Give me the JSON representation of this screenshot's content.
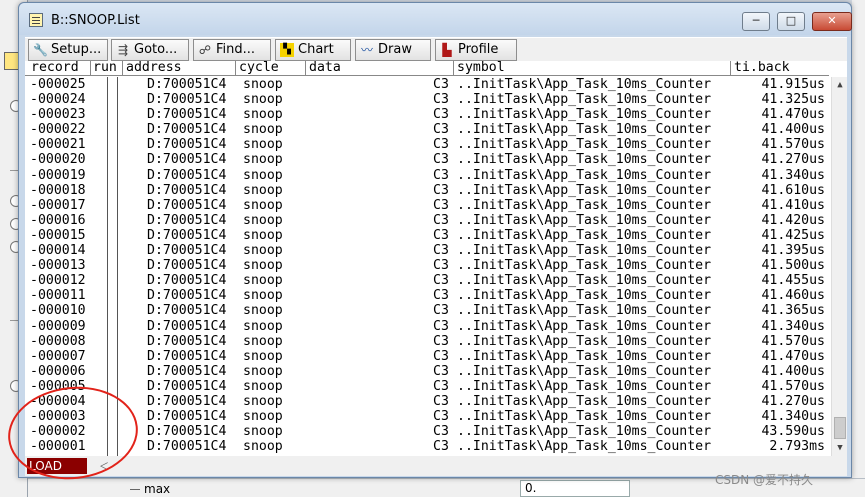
{
  "window": {
    "title": "B::SNOOP.List"
  },
  "title_buttons": {
    "minimize": "─",
    "maximize": "□",
    "close": "✕"
  },
  "toolbar": [
    {
      "label": "Setup...",
      "icon": "wrench-icon"
    },
    {
      "label": "Goto...",
      "icon": "goto-icon"
    },
    {
      "label": "Find...",
      "icon": "binoculars-icon"
    },
    {
      "label": "Chart",
      "icon": "chart-icon"
    },
    {
      "label": "Draw",
      "icon": "draw-icon"
    },
    {
      "label": "Profile",
      "icon": "profile-icon"
    }
  ],
  "columns": [
    "record",
    "run",
    "address",
    "cycle",
    "data",
    "symbol",
    "ti.back"
  ],
  "rows": [
    [
      "-000025",
      "D:700051C4",
      "snoop",
      "C3",
      "..InitTask\\App_Task_10ms_Counter",
      "41.915us"
    ],
    [
      "-000024",
      "D:700051C4",
      "snoop",
      "C3",
      "..InitTask\\App_Task_10ms_Counter",
      "41.325us"
    ],
    [
      "-000023",
      "D:700051C4",
      "snoop",
      "C3",
      "..InitTask\\App_Task_10ms_Counter",
      "41.470us"
    ],
    [
      "-000022",
      "D:700051C4",
      "snoop",
      "C3",
      "..InitTask\\App_Task_10ms_Counter",
      "41.400us"
    ],
    [
      "-000021",
      "D:700051C4",
      "snoop",
      "C3",
      "..InitTask\\App_Task_10ms_Counter",
      "41.570us"
    ],
    [
      "-000020",
      "D:700051C4",
      "snoop",
      "C3",
      "..InitTask\\App_Task_10ms_Counter",
      "41.270us"
    ],
    [
      "-000019",
      "D:700051C4",
      "snoop",
      "C3",
      "..InitTask\\App_Task_10ms_Counter",
      "41.340us"
    ],
    [
      "-000018",
      "D:700051C4",
      "snoop",
      "C3",
      "..InitTask\\App_Task_10ms_Counter",
      "41.610us"
    ],
    [
      "-000017",
      "D:700051C4",
      "snoop",
      "C3",
      "..InitTask\\App_Task_10ms_Counter",
      "41.410us"
    ],
    [
      "-000016",
      "D:700051C4",
      "snoop",
      "C3",
      "..InitTask\\App_Task_10ms_Counter",
      "41.420us"
    ],
    [
      "-000015",
      "D:700051C4",
      "snoop",
      "C3",
      "..InitTask\\App_Task_10ms_Counter",
      "41.425us"
    ],
    [
      "-000014",
      "D:700051C4",
      "snoop",
      "C3",
      "..InitTask\\App_Task_10ms_Counter",
      "41.395us"
    ],
    [
      "-000013",
      "D:700051C4",
      "snoop",
      "C3",
      "..InitTask\\App_Task_10ms_Counter",
      "41.500us"
    ],
    [
      "-000012",
      "D:700051C4",
      "snoop",
      "C3",
      "..InitTask\\App_Task_10ms_Counter",
      "41.455us"
    ],
    [
      "-000011",
      "D:700051C4",
      "snoop",
      "C3",
      "..InitTask\\App_Task_10ms_Counter",
      "41.460us"
    ],
    [
      "-000010",
      "D:700051C4",
      "snoop",
      "C3",
      "..InitTask\\App_Task_10ms_Counter",
      "41.365us"
    ],
    [
      "-000009",
      "D:700051C4",
      "snoop",
      "C3",
      "..InitTask\\App_Task_10ms_Counter",
      "41.340us"
    ],
    [
      "-000008",
      "D:700051C4",
      "snoop",
      "C3",
      "..InitTask\\App_Task_10ms_Counter",
      "41.570us"
    ],
    [
      "-000007",
      "D:700051C4",
      "snoop",
      "C3",
      "..InitTask\\App_Task_10ms_Counter",
      "41.470us"
    ],
    [
      "-000006",
      "D:700051C4",
      "snoop",
      "C3",
      "..InitTask\\App_Task_10ms_Counter",
      "41.400us"
    ],
    [
      "-000005",
      "D:700051C4",
      "snoop",
      "C3",
      "..InitTask\\App_Task_10ms_Counter",
      "41.570us"
    ],
    [
      "-000004",
      "D:700051C4",
      "snoop",
      "C3",
      "..InitTask\\App_Task_10ms_Counter",
      "41.270us"
    ],
    [
      "-000003",
      "D:700051C4",
      "snoop",
      "C3",
      "..InitTask\\App_Task_10ms_Counter",
      "41.340us"
    ],
    [
      "-000002",
      "D:700051C4",
      "snoop",
      "C3",
      "..InitTask\\App_Task_10ms_Counter",
      "43.590us"
    ],
    [
      "-000001",
      "D:700051C4",
      "snoop",
      "C3",
      "..InitTask\\App_Task_10ms_Counter",
      "2.793ms"
    ]
  ],
  "status": {
    "load": "LOAD"
  },
  "background": {
    "max_label": "max",
    "value": "0."
  },
  "watermark": "CSDN @爱不持久",
  "colors": {
    "load_bg": "#8b0000",
    "annotation": "#e2231a",
    "title_bg": "#c8d8ea"
  }
}
